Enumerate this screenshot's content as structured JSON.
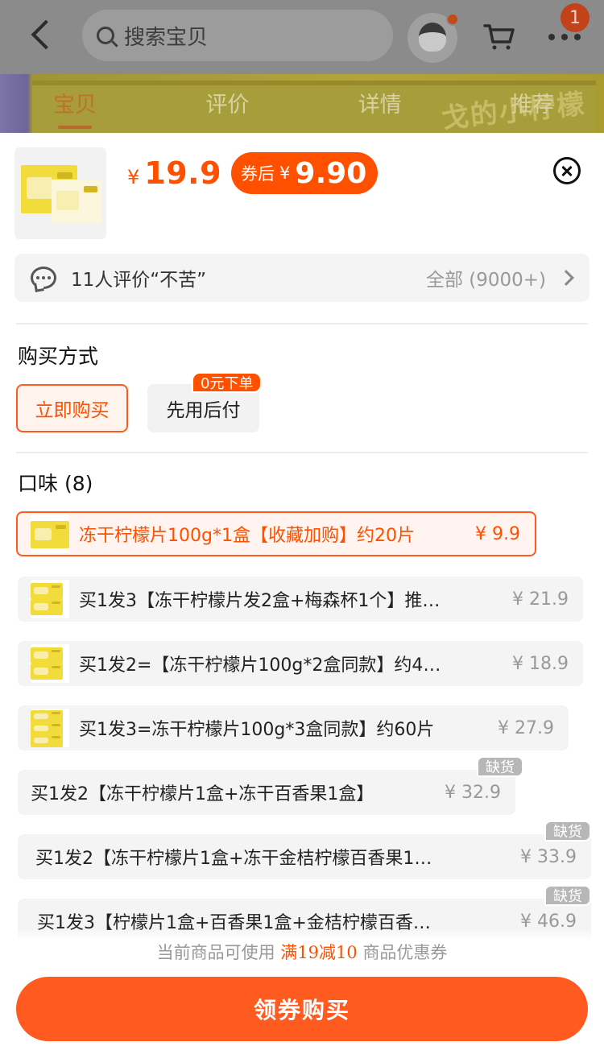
{
  "header": {
    "search_placeholder": "搜索宝贝",
    "more_badge_count": "1",
    "icons": [
      "back-icon",
      "search-icon",
      "avatar",
      "cart-icon",
      "more-icon"
    ]
  },
  "background_tabs": [
    "宝贝",
    "评价",
    "详情",
    "推荐"
  ],
  "background_brand": "戈的小柠檬",
  "sheet": {
    "price": {
      "currency": "¥",
      "value": "19.9",
      "coupon_label": "券后",
      "coupon_currency": "¥",
      "coupon_value": "9.90"
    },
    "review": {
      "text": "11人评价“不苦”",
      "all_label": "全部 (9000+)"
    },
    "purchase_method": {
      "title": "购买方式",
      "options": [
        "立即购买",
        "先用后付"
      ],
      "pay_later_tag": "0元下单",
      "selected": "立即购买"
    },
    "flavor": {
      "title": "口味 (8)",
      "options": [
        {
          "text": "冻干柠檬片100g*1盒【收藏加购】约20片",
          "price": "¥ 9.9",
          "selected": true,
          "out_of_stock": false
        },
        {
          "text": "买1发3【冻干柠檬片发2盒+梅森杯1个】推…",
          "price": "¥ 21.9",
          "selected": false,
          "out_of_stock": false
        },
        {
          "text": "买1发2=【冻干柠檬片100g*2盒同款】约4…",
          "price": "¥ 18.9",
          "selected": false,
          "out_of_stock": false
        },
        {
          "text": "买1发3=冻干柠檬片100g*3盒同款】约60片",
          "price": "¥ 27.9",
          "selected": false,
          "out_of_stock": false
        },
        {
          "text": "买1发2【冻干柠檬片1盒+冻干百香果1盒】",
          "price": "¥ 32.9",
          "selected": false,
          "out_of_stock": true
        },
        {
          "text": "买1发2【冻干柠檬片1盒+冻干金桔柠檬百香果1…",
          "price": "¥ 33.9",
          "selected": false,
          "out_of_stock": true
        },
        {
          "text": "买1发3【柠檬片1盒+百香果1盒+金桔柠檬百香…",
          "price": "¥ 46.9",
          "selected": false,
          "out_of_stock": true
        }
      ],
      "out_of_stock_label": "缺货"
    },
    "coupon_hint": {
      "prefix": "当前商品可使用",
      "highlight": "满19减10",
      "suffix": "商品优惠券"
    },
    "main_button": "领券购买"
  },
  "colors": {
    "accent": "#ff5000",
    "overlay": "#8b8b8b",
    "chip_bg": "#f4f4f4",
    "out_of_stock_badge": "#b7b7b7"
  }
}
